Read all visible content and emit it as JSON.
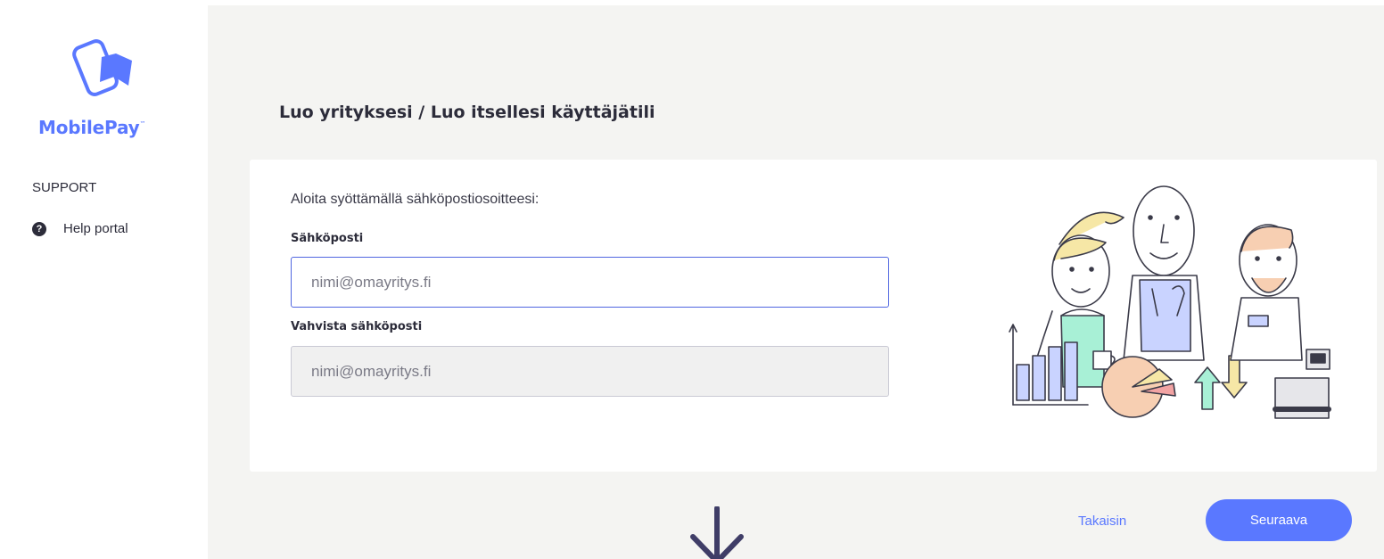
{
  "brand": {
    "name": "MobilePay",
    "trademark": "™",
    "color": "#5a78ff"
  },
  "sidebar": {
    "section_heading": "SUPPORT",
    "items": [
      {
        "icon": "question-circle-icon",
        "label": "Help portal"
      }
    ]
  },
  "page": {
    "title": "Luo yrityksesi / Luo itsellesi käyttäjätili"
  },
  "form": {
    "intro": "Aloita syöttämällä sähköpostiosoitteesi:",
    "email": {
      "label": "Sähköposti",
      "value": "",
      "placeholder": "nimi@omayritys.fi"
    },
    "confirm_email": {
      "label": "Vahvista sähköposti",
      "value": "",
      "placeholder": "nimi@omayritys.fi"
    }
  },
  "actions": {
    "back_label": "Takaisin",
    "next_label": "Seuraava"
  },
  "icons": {
    "help": "question-circle-icon",
    "scroll": "arrow-down-icon",
    "illustration": "business-people-illustration"
  }
}
